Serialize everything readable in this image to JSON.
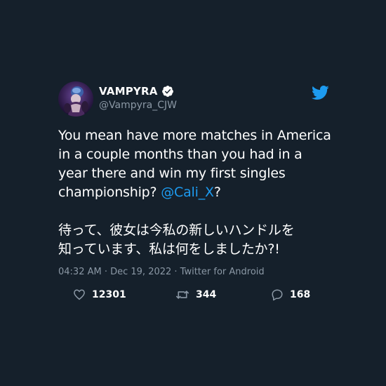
{
  "author": {
    "display_name": "VAMPYRA",
    "handle": "@Vampyra_CJW",
    "verified": true
  },
  "tweet": {
    "text_lines": [
      "You mean have more matches in America",
      "in a couple months than you had in a",
      "year there and win my first singles",
      "championship? "
    ],
    "mention": "@Cali_X",
    "mention_suffix": "?",
    "jp_lines": [
      "待って、彼女は今私の新しいハンドルを",
      "知っています、私は何をしましたか?!"
    ]
  },
  "meta": {
    "time": "04:32 AM",
    "date": "Dec 19, 2022",
    "source": "Twitter for Android",
    "full": "04:32 AM · Dec 19, 2022 · Twitter for Android"
  },
  "actions": {
    "likes": "12301",
    "retweets": "344",
    "replies": "168"
  },
  "icons": {
    "brand": "twitter-bird-icon",
    "verified": "verified-badge-icon",
    "like": "heart-icon",
    "retweet": "retweet-icon",
    "reply": "reply-bubble-icon"
  },
  "colors": {
    "background": "#15202b",
    "text": "#ffffff",
    "secondary_text": "#8b98a5",
    "accent": "#1d9bf0"
  }
}
